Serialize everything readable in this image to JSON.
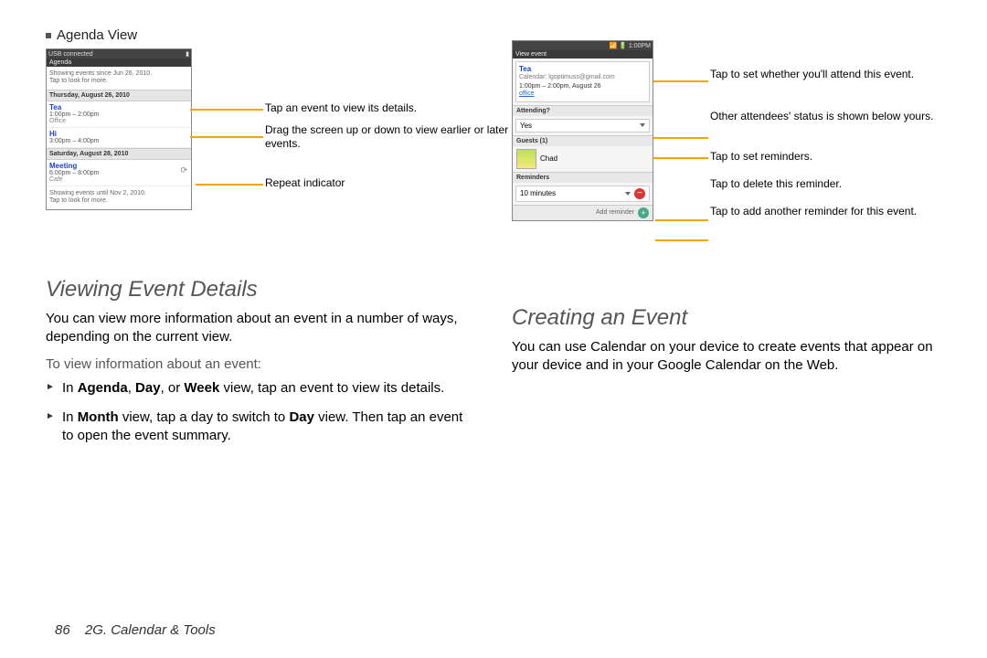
{
  "left": {
    "bulletHeading": "Agenda View",
    "phone": {
      "status": "USB connected",
      "agendaLabel": "Agenda",
      "topInfo1": "Showing events since Jun 26, 2010.",
      "topInfo2": "Tap to look for more.",
      "day1": "Thursday, August 26, 2010",
      "evt1_title": "Tea",
      "evt1_time": "1:00pm – 2:00pm",
      "evt1_loc": "Office",
      "evt2_title": "Hi",
      "evt2_time": "3:00pm – 4:00pm",
      "day2": "Saturday, August 28, 2010",
      "evt3_title": "Meeting",
      "evt3_time": "6:00pm – 8:00pm",
      "evt3_loc": "Cafe",
      "bottomInfo1": "Showing events until Nov 2, 2010.",
      "bottomInfo2": "Tap to look for more."
    },
    "callouts": {
      "c1": "Tap an event to view its details.",
      "c2": "Drag the screen up or down to view earlier or later events.",
      "c3": "Repeat indicator"
    },
    "h2": "Viewing Event Details",
    "para": "You can view more information about an event in a number of ways, depending on the current view.",
    "subhead": "To view information about an event:",
    "step1_pre": "In ",
    "step1_b1": "Agenda",
    "step1_mid1": ", ",
    "step1_b2": "Day",
    "step1_mid2": ", or ",
    "step1_b3": "Week",
    "step1_post": " view, tap an event to view its details.",
    "step2_pre": "In ",
    "step2_b1": "Month",
    "step2_mid": " view, tap a day to switch to ",
    "step2_b2": "Day",
    "step2_post": " view. Then tap an event to open the event summary."
  },
  "right": {
    "phone": {
      "time": "1:00PM",
      "header": "View event",
      "evtTitle": "Tea",
      "evtCal": "Calendar: lgoptimuss@gmail.com",
      "evtDt": "1:00pm – 2:00pm, August 26",
      "evtLoc": "office",
      "attendingLabel": "Attending?",
      "attendingVal": "Yes",
      "guestsLabel": "Guests (1)",
      "guestName": "Chad",
      "remindersLabel": "Reminders",
      "reminderVal": "10 minutes",
      "addReminder": "Add reminder"
    },
    "callouts": {
      "c1": "Tap to set whether you'll attend this event.",
      "c2": "Other attendees' status is shown below yours.",
      "c3": "Tap to set reminders.",
      "c4": "Tap to delete this reminder.",
      "c5": "Tap to add another reminder for this event."
    },
    "h2": "Creating an Event",
    "para": "You can use Calendar on your device to create events that appear on your device and in your Google Calendar on the Web."
  },
  "footer": {
    "page": "86",
    "section": "2G. Calendar & Tools"
  }
}
